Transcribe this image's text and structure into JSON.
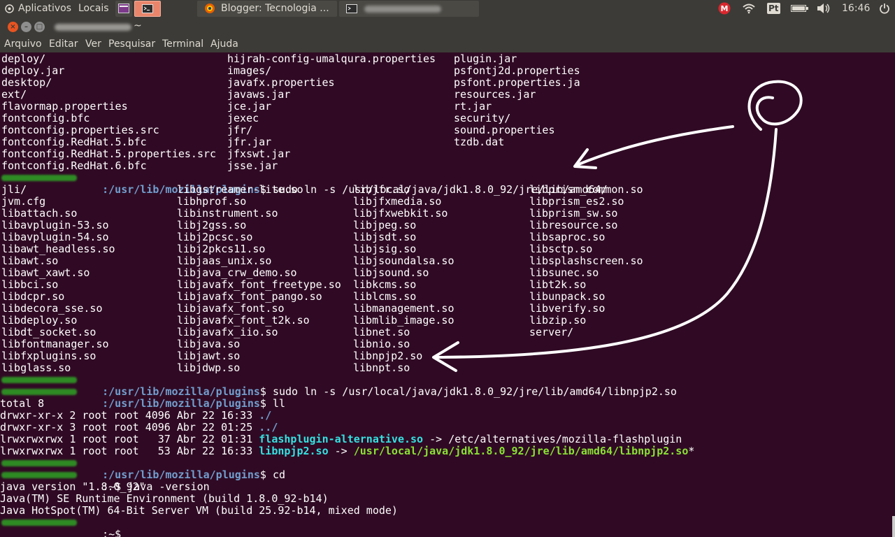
{
  "panel": {
    "apps_label": "Aplicativos",
    "places_label": "Locais",
    "browser_tab_label": "Blogger: Tecnologia ...",
    "indicators": {
      "keyboard": "Pt",
      "time": "16:46"
    },
    "icons": [
      "mega-icon",
      "wifi-icon",
      "keyboard-icon",
      "battery-icon",
      "volume-icon",
      "power-icon"
    ]
  },
  "window": {
    "title_suffix": "~"
  },
  "menu": [
    "Arquivo",
    "Editar",
    "Ver",
    "Pesquisar",
    "Terminal",
    "Ajuda"
  ],
  "terminal": {
    "dir_list_1": [
      [
        "deploy/",
        "hijrah-config-umalqura.properties",
        "plugin.jar"
      ],
      [
        "deploy.jar",
        "images/",
        "psfontj2d.properties"
      ],
      [
        "desktop/",
        "javafx.properties",
        "psfont.properties.ja"
      ],
      [
        "ext/",
        "javaws.jar",
        "resources.jar"
      ],
      [
        "flavormap.properties",
        "jce.jar",
        "rt.jar"
      ],
      [
        "fontconfig.bfc",
        "jexec",
        "security/"
      ],
      [
        "fontconfig.properties.src",
        "jfr/",
        "sound.properties"
      ],
      [
        "fontconfig.RedHat.5.bfc",
        "jfr.jar",
        "tzdb.dat"
      ],
      [
        "fontconfig.RedHat.5.properties.src",
        "jfxswt.jar",
        ""
      ],
      [
        "fontconfig.RedHat.6.bfc",
        "jsse.jar",
        ""
      ]
    ],
    "prompt_path": ":/usr/lib/mozilla/plugins",
    "cmd1": "$ sudo ln -s /usr/local/java/jdk1.8.0_92/jre/lib/amd64/",
    "dir_list_2": [
      [
        "jli/",
        "libgstreamer-lite.so",
        "libjfr.so",
        "libprism_common.so"
      ],
      [
        "jvm.cfg",
        "libhprof.so",
        "libjfxmedia.so",
        "libprism_es2.so"
      ],
      [
        "libattach.so",
        "libinstrument.so",
        "libjfxwebkit.so",
        "libprism_sw.so"
      ],
      [
        "libavplugin-53.so",
        "libj2gss.so",
        "libjpeg.so",
        "libresource.so"
      ],
      [
        "libavplugin-54.so",
        "libj2pcsc.so",
        "libjsdt.so",
        "libsaproc.so"
      ],
      [
        "libawt_headless.so",
        "libj2pkcs11.so",
        "libjsig.so",
        "libsctp.so"
      ],
      [
        "libawt.so",
        "libjaas_unix.so",
        "libjsoundalsa.so",
        "libsplashscreen.so"
      ],
      [
        "libawt_xawt.so",
        "libjava_crw_demo.so",
        "libjsound.so",
        "libsunec.so"
      ],
      [
        "libbci.so",
        "libjavafx_font_freetype.so",
        "libkcms.so",
        "libt2k.so"
      ],
      [
        "libdcpr.so",
        "libjavafx_font_pango.so",
        "liblcms.so",
        "libunpack.so"
      ],
      [
        "libdecora_sse.so",
        "libjavafx_font.so",
        "libmanagement.so",
        "libverify.so"
      ],
      [
        "libdeploy.so",
        "libjavafx_font_t2k.so",
        "libmlib_image.so",
        "libzip.so"
      ],
      [
        "libdt_socket.so",
        "libjavafx_iio.so",
        "libnet.so",
        "server/"
      ],
      [
        "libfontmanager.so",
        "libjava.so",
        "libnio.so",
        ""
      ],
      [
        "libfxplugins.so",
        "libjawt.so",
        "libnpjp2.so",
        ""
      ],
      [
        "libglass.so",
        "libjdwp.so",
        "libnpt.so",
        ""
      ]
    ],
    "cmd2": "$ sudo ln -s /usr/local/java/jdk1.8.0_92/jre/lib/amd64/libnpjp2.so",
    "cmd3": "$ ll",
    "ll_total": "total 8",
    "ll_dot": "drwxr-xr-x 2 root root 4096 Abr 22 16:33 ",
    "ll_dot_name": "./",
    "ll_dotdot": "drwxr-xr-x 3 root root 4096 Abr 22 01:25 ",
    "ll_dotdot_name": "../",
    "ll_flash_prefix": "lrwxrwxrwx 1 root root   37 Abr 22 01:31 ",
    "ll_flash_name": "flashplugin-alternative.so",
    "ll_flash_target": " -> /etc/alternatives/mozilla-flashplugin",
    "ll_npjp_prefix": "lrwxrwxrwx 1 root root   53 Abr 22 16:33 ",
    "ll_npjp_name": "libnpjp2.so",
    "ll_npjp_arrow": " -> ",
    "ll_npjp_target": "/usr/local/java/jdk1.8.0_92/jre/lib/amd64/libnpjp2.so",
    "ll_npjp_star": "*",
    "cmd4": "$ cd",
    "home_prompt": ":~$",
    "cmd5": " java -version",
    "java_out_1": "java version \"1.8.0_92\"",
    "java_out_2": "Java(TM) SE Runtime Environment (build 1.8.0_92-b14)",
    "java_out_3": "Java HotSpot(TM) 64-Bit Server VM (build 25.92-b14, mixed mode)",
    "final_prompt": ":~$"
  },
  "colors": {
    "terminal_bg": "#300a24",
    "path": "#729fcf",
    "link": "#34e2e2",
    "exec": "#8ae234",
    "panel_bg": "#3c3b37"
  }
}
